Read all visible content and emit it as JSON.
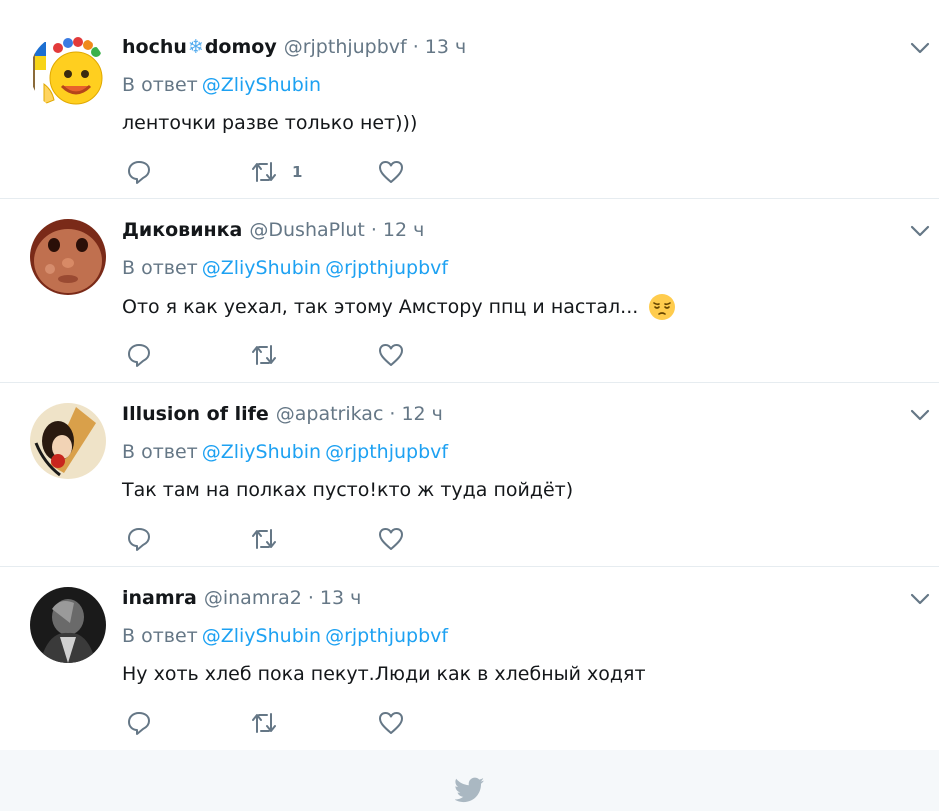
{
  "tweets": [
    {
      "name_part1": "hochu",
      "name_emoji": "❄",
      "name_part2": "domoy",
      "handle": "@rjpthjupbvf",
      "dot": "·",
      "time": "13 ч",
      "reply_prefix": "В ответ",
      "mentions": [
        "@ZliyShubin"
      ],
      "text": "ленточки разве только нет)))",
      "retweet_count": "1",
      "avatar": "avatar-emoji-flag"
    },
    {
      "name": "Диковинка",
      "handle": "@DushaPlut",
      "dot": "·",
      "time": "12 ч",
      "reply_prefix": "В ответ",
      "mentions": [
        "@ZliyShubin",
        "@rjpthjupbvf"
      ],
      "text": "Ото я как уехал, так этому Амстору ппц и настал...",
      "text_emoji": "pensive-face-emoji",
      "avatar": "avatar-clay-face"
    },
    {
      "name": "Illusion of life",
      "handle": "@apatrikac",
      "dot": "·",
      "time": "12 ч",
      "reply_prefix": "В ответ",
      "mentions": [
        "@ZliyShubin",
        "@rjpthjupbvf"
      ],
      "text": "Так там на полках пусто!кто ж туда пойдёт)",
      "avatar": "avatar-drawing"
    },
    {
      "name": "inamra",
      "handle": "@inamra2",
      "dot": "·",
      "time": "13 ч",
      "reply_prefix": "В ответ",
      "mentions": [
        "@ZliyShubin",
        "@rjpthjupbvf"
      ],
      "text": "Ну хоть хлеб пока пекут.Люди как в хлебный ходят",
      "avatar": "avatar-dark-portrait"
    }
  ],
  "icons": {
    "reply": "reply-icon",
    "retweet": "retweet-icon",
    "like": "heart-icon",
    "more": "chevron-down-icon",
    "footer": "twitter-bird-icon"
  },
  "colors": {
    "link": "#1da1f2",
    "secondary": "#657786",
    "divider": "#e6ecf0",
    "footer_bg": "#f5f8fa",
    "bird": "#aab8c2"
  }
}
